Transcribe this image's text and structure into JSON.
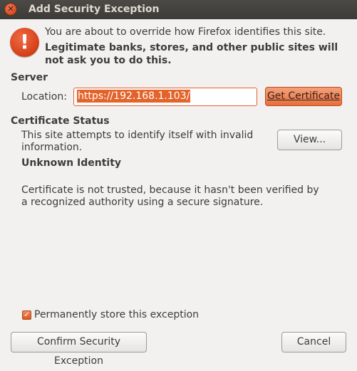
{
  "window": {
    "title": "Add Security Exception",
    "close_glyph": "✕"
  },
  "message": {
    "line1": "You are about to override how Firefox identifies this site.",
    "line2": "Legitimate banks, stores, and other public sites will not ask you to do this.",
    "alert_glyph": "!"
  },
  "server": {
    "heading": "Server",
    "location_label": "Location:",
    "location_value": "https://192.168.1.103/",
    "get_certificate_label": "Get Certificate"
  },
  "certificate_status": {
    "heading": "Certificate Status",
    "description": "This site attempts to identify itself with invalid information.",
    "view_label": "View...",
    "identity_heading": "Unknown Identity",
    "identity_detail": "Certificate is not trusted, because it hasn't been verified by a recognized authority using a secure signature."
  },
  "options": {
    "permanent_label": "Permanently store this exception",
    "permanent_checked": true,
    "check_glyph": "✓"
  },
  "actions": {
    "confirm_label": "Confirm Security Exception",
    "cancel_label": "Cancel"
  },
  "colors": {
    "accent": "#e3642b",
    "titlebar": "#3c3b37",
    "background": "#f2f1f0"
  },
  "icons": [
    "close-icon",
    "alert-icon",
    "check-icon"
  ]
}
